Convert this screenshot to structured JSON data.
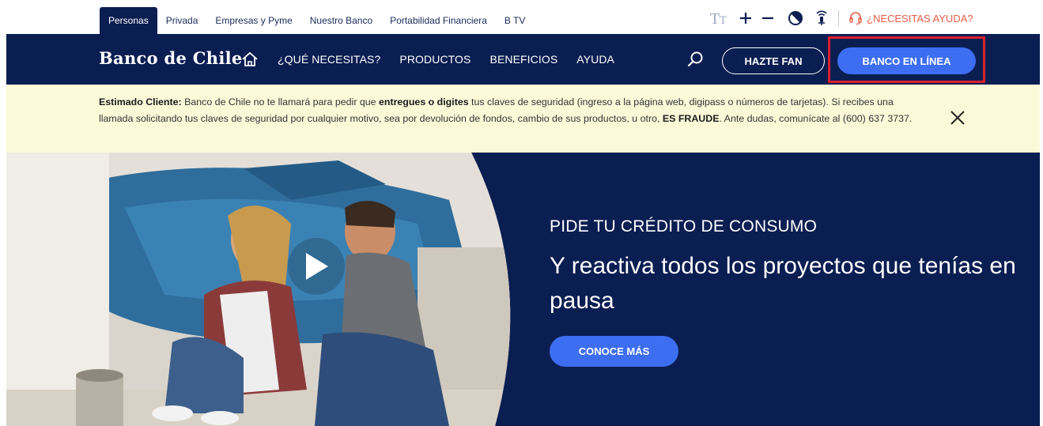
{
  "segments": {
    "items": [
      {
        "label": "Personas",
        "active": true
      },
      {
        "label": "Privada"
      },
      {
        "label": "Empresas y Pyme"
      },
      {
        "label": "Nuestro Banco"
      },
      {
        "label": "Portabilidad Financiera"
      },
      {
        "label": "B TV"
      }
    ]
  },
  "utilities": {
    "text_size_icon": "text-size-icon",
    "increase_icon": "plus-icon",
    "decrease_icon": "minus-icon",
    "contrast_icon": "contrast-icon",
    "audio_icon": "audio-icon",
    "help_label": "¿NECESITAS AYUDA?",
    "help_color": "#e85c45"
  },
  "nav": {
    "logo_text": "Banco de Chile",
    "links": [
      "¿QUÉ NECESITAS?",
      "PRODUCTOS",
      "BENEFICIOS",
      "AYUDA"
    ],
    "fan_label": "HAZTE FAN",
    "online_label": "BANCO EN LÍNEA",
    "bg_color": "#0b1e52",
    "accent_color": "#3d6ef2",
    "highlight_color": "#d9202e"
  },
  "alert": {
    "lead": "Estimado Cliente:",
    "p1": " Banco de Chile no te llamará para pedir que ",
    "em1": "entregues o digites",
    "p2": " tus claves de seguridad (ingreso a la página web, digipass o números de tarjetas). Si recibes una llamada solicitando tus claves de seguridad por cualquier motivo, sea por devolución de fondos, cambio de sus productos, u otro, ",
    "em2": "ES FRAUDE",
    "p3": ". Ante dudas, comunícate al (600) 637 3737.",
    "bg_color": "#fcf9d9"
  },
  "hero": {
    "kicker": "PIDE TU CRÉDITO DE CONSUMO",
    "title": "Y reactiva todos los proyectos que tenías en pausa",
    "cta_label": "CONOCE MÁS"
  }
}
